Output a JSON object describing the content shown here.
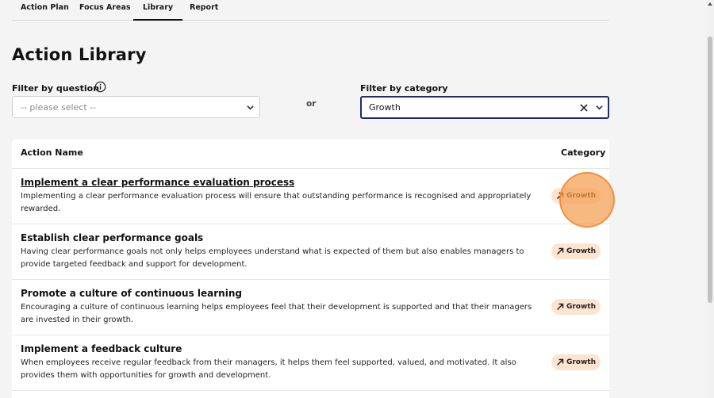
{
  "tabs": [
    {
      "label": "Action Plan",
      "active": false
    },
    {
      "label": "Focus Areas",
      "active": false
    },
    {
      "label": "Library",
      "active": true
    },
    {
      "label": "Report",
      "active": false
    }
  ],
  "page_title": "Action Library",
  "filters": {
    "question_label": "Filter by question",
    "question_placeholder": "-- please select --",
    "or_text": "or",
    "category_label": "Filter by category",
    "category_value": "Growth"
  },
  "table": {
    "headers": {
      "name": "Action Name",
      "category": "Category"
    },
    "rows": [
      {
        "title": "Implement a clear performance evaluation process",
        "description": "Implementing a clear performance evaluation process will ensure that outstanding performance is recognised and appropriately rewarded.",
        "category": "Growth"
      },
      {
        "title": "Establish clear performance goals",
        "description": "Having clear performance goals not only helps employees understand what is expected of them but also enables managers to provide targeted feedback and support for development.",
        "category": "Growth"
      },
      {
        "title": "Promote a culture of continuous learning",
        "description": "Encouraging a culture of continuous learning helps employees feel that their development is supported and that their managers are invested in their growth.",
        "category": "Growth"
      },
      {
        "title": "Implement a feedback culture",
        "description": "When employees receive regular feedback from their managers, it helps them feel supported, valued, and motivated. It also provides them with opportunities for growth and development.",
        "category": "Growth"
      }
    ]
  },
  "colors": {
    "accent_border": "#1f2d6b",
    "badge_bg": "#fde4cf",
    "highlight": "#f59e50"
  },
  "icons": {
    "info": "info-circle-icon",
    "chevron": "chevron-down-icon",
    "clear": "close-icon",
    "category": "trend-arrow-up-right-icon"
  }
}
